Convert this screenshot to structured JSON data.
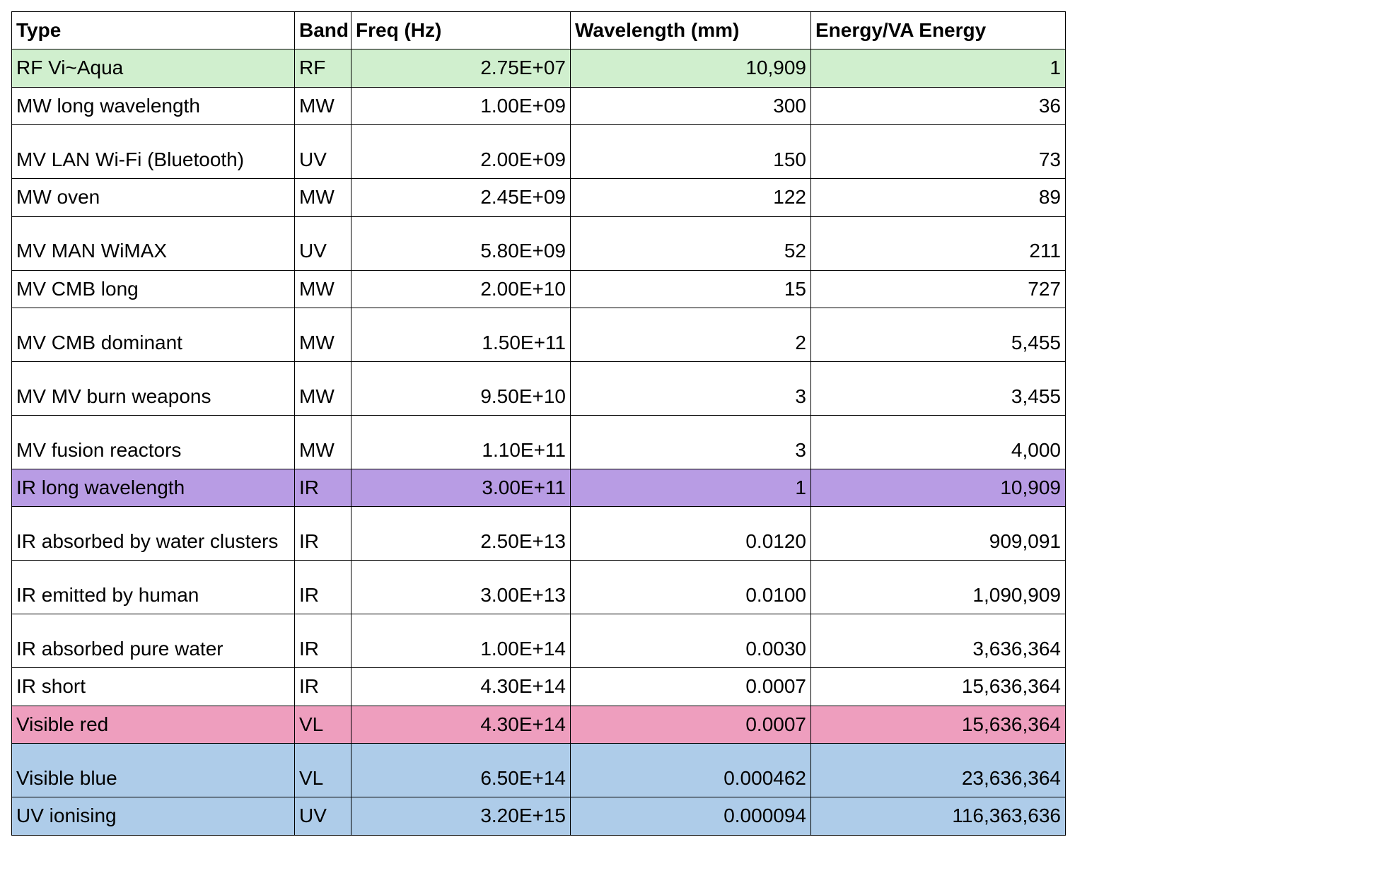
{
  "chart_data": {
    "type": "table",
    "title": "",
    "columns": [
      "Type",
      "Band",
      "Freq (Hz)",
      "Wavelength (mm)",
      "Energy/VA Energy"
    ],
    "rows": [
      {
        "type": "RF Vi~Aqua",
        "band": "RF",
        "freq": "2.75E+07",
        "wavelength": "10,909",
        "energy": "1",
        "highlight": "green"
      },
      {
        "type": "MW long wavelength",
        "band": "MW",
        "freq": "1.00E+09",
        "wavelength": "300",
        "energy": "36",
        "highlight": ""
      },
      {
        "type": "MV LAN Wi-Fi (Bluetooth)",
        "band": "UV",
        "freq": "2.00E+09",
        "wavelength": "150",
        "energy": "73",
        "highlight": ""
      },
      {
        "type": "MW oven",
        "band": "MW",
        "freq": "2.45E+09",
        "wavelength": "122",
        "energy": "89",
        "highlight": ""
      },
      {
        "type": "MV MAN WiMAX",
        "band": "UV",
        "freq": "5.80E+09",
        "wavelength": "52",
        "energy": "211",
        "highlight": ""
      },
      {
        "type": "MV CMB long",
        "band": "MW",
        "freq": "2.00E+10",
        "wavelength": "15",
        "energy": "727",
        "highlight": ""
      },
      {
        "type": "MV CMB dominant",
        "band": "MW",
        "freq": "1.50E+11",
        "wavelength": "2",
        "energy": "5,455",
        "highlight": ""
      },
      {
        "type": "MV MV burn weapons",
        "band": "MW",
        "freq": "9.50E+10",
        "wavelength": "3",
        "energy": "3,455",
        "highlight": ""
      },
      {
        "type": "MV fusion reactors",
        "band": "MW",
        "freq": "1.10E+11",
        "wavelength": "3",
        "energy": "4,000",
        "highlight": ""
      },
      {
        "type": "IR long wavelength",
        "band": "IR",
        "freq": "3.00E+11",
        "wavelength": "1",
        "energy": "10,909",
        "highlight": "purple"
      },
      {
        "type": "IR absorbed by water clusters",
        "band": "IR",
        "freq": "2.50E+13",
        "wavelength": "0.0120",
        "energy": "909,091",
        "highlight": ""
      },
      {
        "type": "IR emitted by human",
        "band": "IR",
        "freq": "3.00E+13",
        "wavelength": "0.0100",
        "energy": "1,090,909",
        "highlight": ""
      },
      {
        "type": "IR absorbed pure water",
        "band": "IR",
        "freq": "1.00E+14",
        "wavelength": "0.0030",
        "energy": "3,636,364",
        "highlight": ""
      },
      {
        "type": "IR short",
        "band": "IR",
        "freq": "4.30E+14",
        "wavelength": "0.0007",
        "energy": "15,636,364",
        "highlight": ""
      },
      {
        "type": "Visible red",
        "band": "VL",
        "freq": "4.30E+14",
        "wavelength": "0.0007",
        "energy": "15,636,364",
        "highlight": "pink"
      },
      {
        "type": "Visible blue",
        "band": "VL",
        "freq": "6.50E+14",
        "wavelength": "0.000462",
        "energy": "23,636,364",
        "highlight": "blue"
      },
      {
        "type": "UV ionising",
        "band": "UV",
        "freq": "3.20E+15",
        "wavelength": "0.000094",
        "energy": "116,363,636",
        "highlight": "blue"
      }
    ],
    "tall_rows": [
      2,
      4,
      6,
      7,
      8,
      10,
      11,
      12,
      15
    ]
  },
  "colors": {
    "green": "#d0efce",
    "purple": "#b89ce4",
    "pink": "#ee9ebe",
    "blue": "#aecce9"
  }
}
